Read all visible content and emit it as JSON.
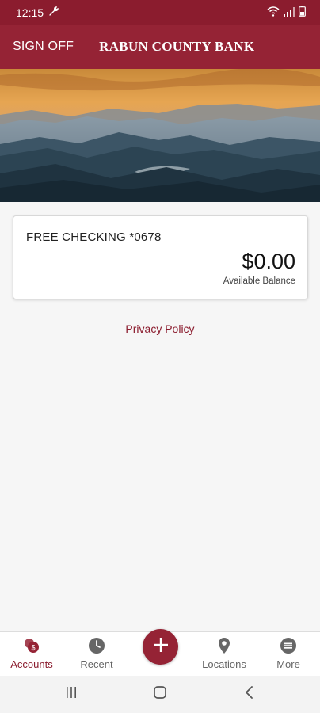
{
  "status_bar": {
    "time": "12:15",
    "icons": [
      "wrench-icon",
      "wifi-icon",
      "signal-icon",
      "battery-icon"
    ]
  },
  "header": {
    "sign_off_label": "SIGN OFF",
    "title": "RABUN COUNTY BANK"
  },
  "accounts": [
    {
      "name": "FREE CHECKING *0678",
      "balance": "$0.00",
      "balance_label": "Available Balance"
    }
  ],
  "privacy_link": "Privacy Policy",
  "tabs": [
    {
      "label": "Accounts",
      "icon": "accounts-icon",
      "active": true
    },
    {
      "label": "Recent",
      "icon": "clock-icon",
      "active": false
    },
    {
      "label": "",
      "icon": "plus-icon",
      "active": false
    },
    {
      "label": "Locations",
      "icon": "location-pin-icon",
      "active": false
    },
    {
      "label": "More",
      "icon": "menu-icon",
      "active": false
    }
  ],
  "colors": {
    "brand": "#952335",
    "status_bar": "#8b1c2e",
    "background": "#f6f6f6",
    "inactive_tab": "#666666"
  },
  "system_nav": [
    "recents-icon",
    "home-icon",
    "back-icon"
  ]
}
